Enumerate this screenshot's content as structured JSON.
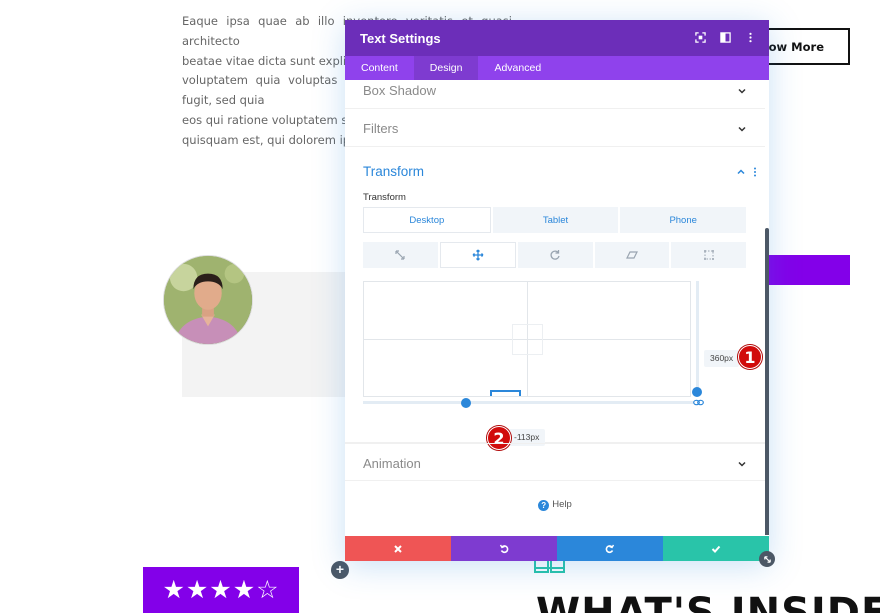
{
  "background": {
    "paragraph_lines": [
      "Eaque ipsa quae ab illo inventore veritatis et quasi architecto",
      "beatae vitae dicta sunt explicabo. Nemo enim ipsam",
      "voluptatem quia voluptas sit aspernatur aut odit aut fugit, sed quia",
      "eos qui ratione voluptatem sequi nesciunt. Neque porro",
      "quisquam est, qui dolorem ipsum"
    ],
    "know_more_label": "Know More",
    "rating_stars": "★★★★☆",
    "heading": "WHAT'S INSIDE",
    "add_button": "+"
  },
  "modal": {
    "title": "Text Settings",
    "header_icons": [
      "expand-icon",
      "split-view-icon",
      "more-vertical-icon"
    ],
    "tabs": [
      {
        "label": "Content",
        "active": false
      },
      {
        "label": "Design",
        "active": true
      },
      {
        "label": "Advanced",
        "active": false
      }
    ],
    "sections": {
      "box_shadow": "Box Shadow",
      "filters": "Filters",
      "transform": "Transform",
      "animation": "Animation"
    },
    "transform": {
      "field_label": "Transform",
      "device_tabs": [
        {
          "label": "Desktop",
          "active": true
        },
        {
          "label": "Tablet",
          "active": false
        },
        {
          "label": "Phone",
          "active": false
        }
      ],
      "tool_tabs": [
        {
          "icon": "scale-icon",
          "active": false
        },
        {
          "icon": "translate-icon",
          "active": true
        },
        {
          "icon": "rotate-icon",
          "active": false
        },
        {
          "icon": "skew-icon",
          "active": false
        },
        {
          "icon": "origin-icon",
          "active": false
        }
      ],
      "translate_y_value": "360px",
      "translate_x_value": "-113px"
    },
    "markers": {
      "first": "1",
      "second": "2"
    },
    "help_label": "Help",
    "footer_buttons": [
      {
        "icon": "close-icon",
        "color": "#ef5555"
      },
      {
        "icon": "undo-icon",
        "color": "#7e3bd0"
      },
      {
        "icon": "redo-icon",
        "color": "#2b87da"
      },
      {
        "icon": "check-icon",
        "color": "#29c4a9"
      }
    ]
  },
  "colors": {
    "modal_header": "#6c2eb9",
    "modal_tabs": "#8f42ec",
    "accent_blue": "#2b87da",
    "brand_purple": "#8300e9",
    "marker_red": "#d10b0b"
  }
}
